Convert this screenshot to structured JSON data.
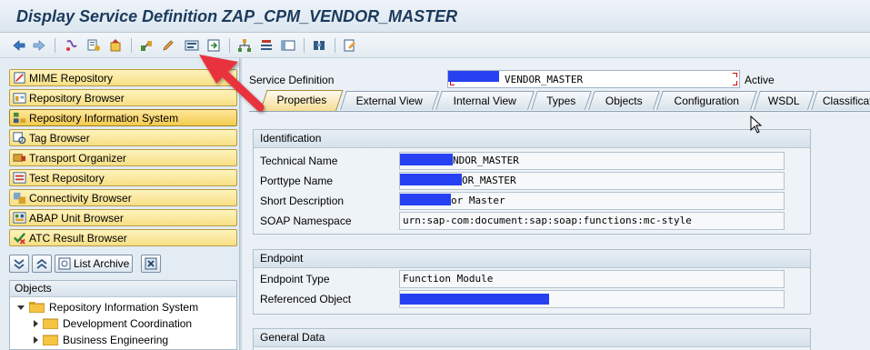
{
  "window": {
    "title": "Display Service Definition ZAP_CPM_VENDOR_MASTER"
  },
  "toolbar": {
    "icons": [
      "back-arrow-icon",
      "forward-arrow-icon",
      "other-object-icon",
      "display-change-icon",
      "activate-icon",
      "where-used-icon",
      "edit-pencil-icon",
      "object-list-icon",
      "navigation-window-icon",
      "hierarchy-icon",
      "enhance-icon",
      "layout-icon",
      "info-icon",
      "help-icon"
    ]
  },
  "nav": {
    "buttons": [
      {
        "label": "MIME Repository",
        "icon": "mime-icon"
      },
      {
        "label": "Repository Browser",
        "icon": "repository-icon"
      },
      {
        "label": "Repository Information System",
        "icon": "info-system-icon"
      },
      {
        "label": "Tag Browser",
        "icon": "tag-icon"
      },
      {
        "label": "Transport Organizer",
        "icon": "transport-icon"
      },
      {
        "label": "Test Repository",
        "icon": "test-icon"
      },
      {
        "label": "Connectivity Browser",
        "icon": "connectivity-icon"
      },
      {
        "label": "ABAP Unit Browser",
        "icon": "unit-icon"
      },
      {
        "label": "ATC Result Browser",
        "icon": "atc-icon"
      }
    ],
    "list_archive_label": "List Archive"
  },
  "objects": {
    "header": "Objects",
    "tree": [
      {
        "label": "Repository Information System",
        "expanded": true
      },
      {
        "label": "Development Coordination",
        "expanded": false
      },
      {
        "label": "Business Engineering",
        "expanded": false
      }
    ]
  },
  "service": {
    "label": "Service Definition",
    "value": "VENDOR_MASTER",
    "status": "Active"
  },
  "tabs": [
    {
      "label": "Properties",
      "selected": true
    },
    {
      "label": "External View",
      "selected": false
    },
    {
      "label": "Internal View",
      "selected": false
    },
    {
      "label": "Types",
      "selected": false
    },
    {
      "label": "Objects",
      "selected": false
    },
    {
      "label": "Configuration",
      "selected": false
    },
    {
      "label": "WSDL",
      "selected": false
    },
    {
      "label": "Classifications",
      "selected": false
    }
  ],
  "identification": {
    "header": "Identification",
    "technical_name": {
      "label": "Technical Name",
      "value": "NDOR_MASTER"
    },
    "porttype_name": {
      "label": "Porttype Name",
      "value": "OR_MASTER"
    },
    "short_description": {
      "label": "Short Description",
      "value": "or Master"
    },
    "soap_namespace": {
      "label": "SOAP Namespace",
      "value": "urn:sap-com:document:sap:soap:functions:mc-style"
    }
  },
  "endpoint": {
    "header": "Endpoint",
    "endpoint_type": {
      "label": "Endpoint Type",
      "value": "Function Module"
    },
    "referenced_object": {
      "label": "Referenced Object",
      "value": ""
    }
  },
  "general": {
    "header": "General Data"
  },
  "colors": {
    "redaction": "#2741f2",
    "annotation_arrow": "#e8323c",
    "nav_button": "#f7df85",
    "selected_tab": "#f6dd93"
  }
}
